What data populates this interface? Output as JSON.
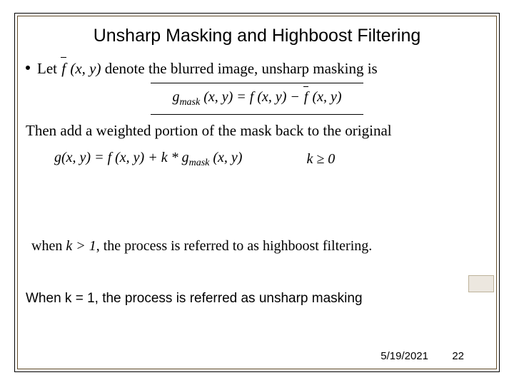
{
  "title": "Unsharp Masking and Highboost Filtering",
  "lines": {
    "let_prefix": "Let ",
    "fbar": "f",
    "let_args": " (x, y)",
    "let_suffix": " denote the blurred image, unsharp masking is",
    "eq1_lhs": "g",
    "eq1_sub": "mask",
    "eq1_mid": " (x, y) = f (x, y) − ",
    "eq1_tail": " (x, y)",
    "then_line": "Then add a weighted portion of the mask back to the original",
    "eq2_lhs": "g(x, y) = f (x, y) + k * g",
    "eq2_sub": "mask",
    "eq2_tail": " (x, y)",
    "k_cond": "k ≥ 0",
    "highboost_prefix": "when ",
    "highboost_k": "k > 1",
    "highboost_suffix": ", the process is referred to as highboost filtering.",
    "unsharp_note": "When k = 1, the process is referred as unsharp masking"
  },
  "footer": {
    "date": "5/19/2021",
    "page": "22"
  }
}
